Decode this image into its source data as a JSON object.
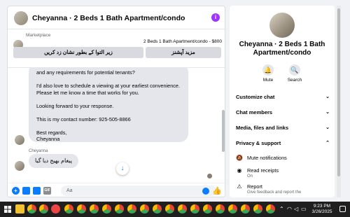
{
  "chat": {
    "title": "Cheyanna · 2 Beds 1 Bath Apartment/condo",
    "info_icon": "info-icon",
    "marketplace_label": "Marketplace",
    "listing": "2 Beds 1 Bath Apartment/condo - $800",
    "mark_button": "زیر التوا کے بطور نشان زد کریں",
    "more_button": "مزید آپشنز",
    "message_lines": [
      "and any requirements for potential tenants?",
      "",
      "I'd also love to schedule a viewing at your earliest convenience.",
      "Please let me know a time that works for you.",
      "",
      "Looking forward to your response.",
      "",
      "This is my contact number: 925-505-8866",
      "",
      "Best regards,",
      "Cheyanna"
    ],
    "sender_name": "Cheyanna",
    "short_message": "پیغام بھیج دیا گیا",
    "composer_placeholder": "Aa"
  },
  "info": {
    "title": "Cheyanna · 2 Beds 1 Bath Apartment/condo",
    "actions": [
      {
        "label": "Mute",
        "icon": "bell-icon"
      },
      {
        "label": "Search",
        "icon": "search-icon"
      }
    ],
    "sections": [
      {
        "label": "Customize chat",
        "expanded": false
      },
      {
        "label": "Chat members",
        "expanded": false
      },
      {
        "label": "Media, files and links",
        "expanded": false
      },
      {
        "label": "Privacy & support",
        "expanded": true
      }
    ],
    "privacy_items": [
      {
        "label": "Mute notifications",
        "desc": "",
        "icon": "bell-off-icon"
      },
      {
        "label": "Read receipts",
        "desc": "On",
        "icon": "eye-icon"
      },
      {
        "label": "Report",
        "desc": "Give feedback and report the",
        "icon": "report-icon"
      }
    ]
  },
  "taskbar": {
    "time": "9:23 PM",
    "date": "3/26/2025",
    "tray_icons": [
      "chevron-up-icon",
      "wifi-icon",
      "speaker-icon",
      "battery-icon"
    ]
  },
  "colors": {
    "accent": "#0a7cff",
    "info_purple": "#a033ff",
    "bubble": "#e4e6eb",
    "taskbar": "#1f1f1f"
  }
}
